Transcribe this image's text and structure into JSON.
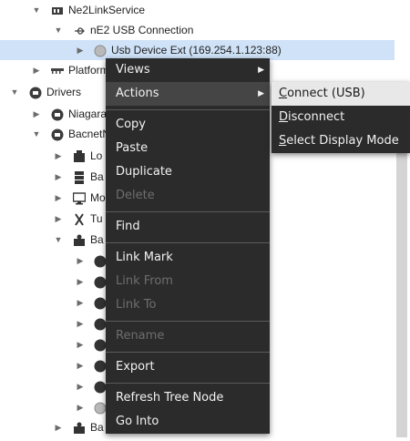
{
  "tree": {
    "ne2link_service": "Ne2LinkService",
    "usb_connection": "nE2 USB Connection",
    "usb_device": "Usb Device Ext (169.254.1.123:88)",
    "platform": "Platform",
    "drivers": "Drivers",
    "niagara": "Niagara",
    "bacnet": "BacnetN",
    "child_lo": "Lo",
    "child_ba": "Ba",
    "child_mo": "Mo",
    "child_tu": "Tu",
    "child_ba2": "Ba",
    "child_ba3": "Ba"
  },
  "context_menu": {
    "items": [
      {
        "label": "Views",
        "has_submenu": true,
        "enabled": true
      },
      {
        "label": "Actions",
        "has_submenu": true,
        "enabled": true
      },
      {
        "label": "Copy",
        "enabled": true
      },
      {
        "label": "Paste",
        "enabled": true
      },
      {
        "label": "Duplicate",
        "enabled": true
      },
      {
        "label": "Delete",
        "enabled": false
      },
      {
        "label": "Find",
        "enabled": true
      },
      {
        "label": "Link Mark",
        "enabled": true
      },
      {
        "label": "Link From",
        "enabled": false
      },
      {
        "label": "Link To",
        "enabled": false
      },
      {
        "label": "Rename",
        "enabled": false
      },
      {
        "label": "Export",
        "enabled": true
      },
      {
        "label": "Refresh Tree Node",
        "enabled": true
      },
      {
        "label": "Go Into",
        "enabled": true
      }
    ]
  },
  "actions_submenu": {
    "items": [
      {
        "label": "Connect (USB)",
        "mnemonic": "C",
        "rest": "onnect (USB)",
        "hovered": true
      },
      {
        "label": "Disconnect",
        "mnemonic": "D",
        "rest": "isconnect"
      },
      {
        "label": "Select Display Mode",
        "mnemonic": "S",
        "rest": "elect Display Mode"
      }
    ]
  },
  "colors": {
    "selection": "#cfe2f7",
    "menu_background": "#2b2b2b",
    "menu_text": "#f2f2f2",
    "disabled_text": "#6e6e6e"
  }
}
